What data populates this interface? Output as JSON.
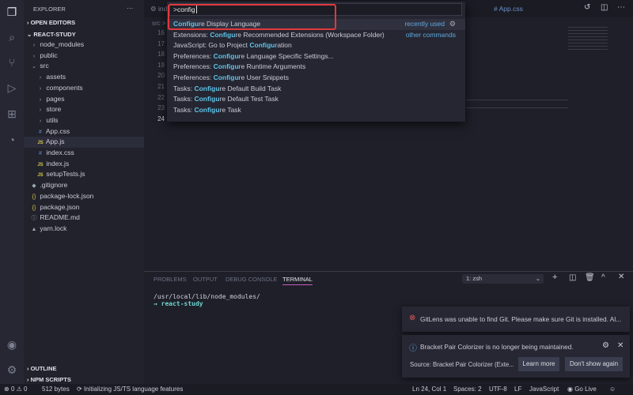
{
  "activity": {
    "icons": [
      "files-icon",
      "search-icon",
      "source-control-icon",
      "run-debug-icon",
      "extensions-icon",
      "gitlens-icon",
      "account-icon",
      "gear-icon"
    ]
  },
  "sidebar": {
    "title": "EXPLORER",
    "more": "···",
    "open_editors": "OPEN EDITORS",
    "project": "REACT-STUDY",
    "items": [
      {
        "label": "node_modules",
        "type": "folder",
        "depth": 1,
        "open": false
      },
      {
        "label": "public",
        "type": "folder",
        "depth": 1,
        "open": false
      },
      {
        "label": "src",
        "type": "folder",
        "depth": 1,
        "open": true
      },
      {
        "label": "assets",
        "type": "folder",
        "depth": 2,
        "open": false
      },
      {
        "label": "components",
        "type": "folder",
        "depth": 2,
        "open": false
      },
      {
        "label": "pages",
        "type": "folder",
        "depth": 2,
        "open": false
      },
      {
        "label": "store",
        "type": "folder",
        "depth": 2,
        "open": false
      },
      {
        "label": "utils",
        "type": "folder",
        "depth": 2,
        "open": false
      },
      {
        "label": "App.css",
        "type": "css",
        "depth": 2
      },
      {
        "label": "App.js",
        "type": "js",
        "depth": 2,
        "selected": true
      },
      {
        "label": "index.css",
        "type": "css",
        "depth": 2
      },
      {
        "label": "index.js",
        "type": "js",
        "depth": 2
      },
      {
        "label": "setupTests.js",
        "type": "js",
        "depth": 2
      },
      {
        "label": ".gitignore",
        "type": "git",
        "depth": 1
      },
      {
        "label": "package-lock.json",
        "type": "json",
        "depth": 1
      },
      {
        "label": "package.json",
        "type": "json",
        "depth": 1
      },
      {
        "label": "README.md",
        "type": "info",
        "depth": 1
      },
      {
        "label": "yarn.lock",
        "type": "yarn",
        "depth": 1
      }
    ],
    "outline": "OUTLINE",
    "npm_scripts": "NPM SCRIPTS"
  },
  "editor": {
    "tab_partial": "ind",
    "tab_app_css": "App.css",
    "breadcrumb": "src >",
    "line_numbers": [
      "16",
      "17",
      "18",
      "19",
      "20",
      "21",
      "22",
      "23",
      "24"
    ]
  },
  "palette": {
    "input": ">config",
    "items": [
      {
        "prefix": "",
        "match": "Configu",
        "suffix": "re Display Language",
        "right": "recently used"
      },
      {
        "prefix": "Extensions: ",
        "match": "Configu",
        "suffix": "re Recommended Extensions (Workspace Folder)",
        "right": "other commands"
      },
      {
        "prefix": "JavaScript: Go to Project ",
        "match": "Configu",
        "suffix": "ration",
        "right": ""
      },
      {
        "prefix": "Preferences: ",
        "match": "Configu",
        "suffix": "re Language Specific Settings...",
        "right": ""
      },
      {
        "prefix": "Preferences: ",
        "match": "Configu",
        "suffix": "re Runtime Arguments",
        "right": ""
      },
      {
        "prefix": "Preferences: ",
        "match": "Configu",
        "suffix": "re User Snippets",
        "right": ""
      },
      {
        "prefix": "Tasks: ",
        "match": "Configu",
        "suffix": "re Default Build Task",
        "right": ""
      },
      {
        "prefix": "Tasks: ",
        "match": "Configu",
        "suffix": "re Default Test Task",
        "right": ""
      },
      {
        "prefix": "Tasks: ",
        "match": "Configu",
        "suffix": "re Task",
        "right": ""
      }
    ]
  },
  "panel": {
    "tabs": [
      "PROBLEMS",
      "OUTPUT",
      "DEBUG CONSOLE",
      "TERMINAL"
    ],
    "active_tab": "TERMINAL",
    "terminal_select": "1: zsh",
    "lines": [
      "/usr/local/lib/node_modules/",
      "→  react-study"
    ]
  },
  "notifications": {
    "gitlens": "GitLens was unable to find Git. Please make sure Git is installed. Al...",
    "bracket": "Bracket Pair Colorizer is no longer being maintained.",
    "source": "Source: Bracket Pair Colorizer (Exte...",
    "learn_more": "Learn more",
    "dont_show": "Don't show again"
  },
  "status": {
    "errors": "0",
    "warnings": "0",
    "size": "512 bytes",
    "task": "Initializing JS/TS language features",
    "position": "Ln 24, Col 1",
    "spaces": "Spaces: 2",
    "encoding": "UTF-8",
    "eol": "LF",
    "language": "JavaScript",
    "golive": "Go Live"
  },
  "colors": {
    "accent": "#5fc3e8",
    "highlight_box": "#e0393e",
    "error": "#e05a5a",
    "info": "#5fa9e0"
  }
}
